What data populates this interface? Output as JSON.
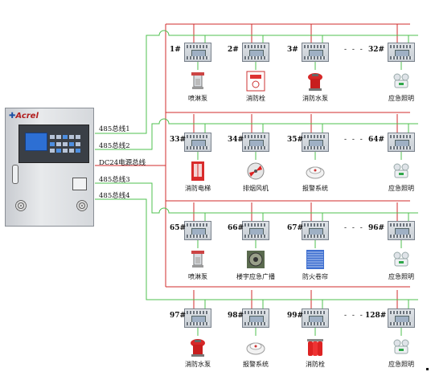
{
  "panel": {
    "brand": "Acrel",
    "icon": "controller-panel-icon"
  },
  "bus_labels": [
    "485总线1",
    "485总线2",
    "DC24电源总线",
    "485总线3",
    "485总线4"
  ],
  "colors": {
    "power_bus": "#d12b2b",
    "signal_bus": "#4fc14f",
    "module": "#c6ccd3"
  },
  "rows": [
    {
      "numbers": [
        "1#",
        "2#",
        "3#",
        "32#"
      ],
      "ellipsis": "- - -",
      "devices": [
        {
          "name": "喷淋泵",
          "icon": "sprinkler-icon"
        },
        {
          "name": "消防栓",
          "icon": "hydrant-box-icon"
        },
        {
          "name": "消防水泵",
          "icon": "fire-pump-icon"
        },
        {
          "name": "应急照明",
          "icon": "emergency-light-icon"
        }
      ]
    },
    {
      "numbers": [
        "33#",
        "34#",
        "35#",
        "64#"
      ],
      "ellipsis": "- - -",
      "devices": [
        {
          "name": "消防电梯",
          "icon": "fire-elevator-icon"
        },
        {
          "name": "排烟风机",
          "icon": "smoke-fan-icon"
        },
        {
          "name": "报警系统",
          "icon": "smoke-detector-icon"
        },
        {
          "name": "应急照明",
          "icon": "emergency-light-icon"
        }
      ]
    },
    {
      "numbers": [
        "65#",
        "66#",
        "67#",
        "96#"
      ],
      "ellipsis": "- - -",
      "devices": [
        {
          "name": "喷淋泵",
          "icon": "sprinkler-icon"
        },
        {
          "name": "楼宇应急广播",
          "icon": "broadcast-speaker-icon"
        },
        {
          "name": "防火卷帘",
          "icon": "fire-shutter-icon"
        },
        {
          "name": "应急照明",
          "icon": "emergency-light-icon"
        }
      ]
    },
    {
      "numbers": [
        "97#",
        "98#",
        "99#",
        "128#"
      ],
      "ellipsis": "- - -",
      "devices": [
        {
          "name": "消防水泵",
          "icon": "fire-pump-icon"
        },
        {
          "name": "报警系统",
          "icon": "smoke-detector-icon"
        },
        {
          "name": "消防栓",
          "icon": "extinguisher-cylinders-icon"
        },
        {
          "name": "应急照明",
          "icon": "emergency-light-icon"
        }
      ]
    }
  ]
}
